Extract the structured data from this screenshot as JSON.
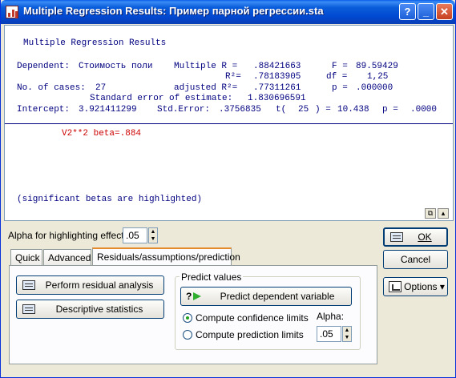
{
  "window": {
    "title": "Multiple Regression Results: Пример парной регрессии.sta"
  },
  "titlebar_buttons": {
    "help": "?",
    "minimize": "_",
    "close": "✕"
  },
  "output": {
    "heading": "Multiple Regression Results",
    "dependent_label": "Dependent:",
    "dependent_value": "Стоимость поли",
    "multiple_r_label": "Multiple R =",
    "multiple_r_value": ".88421663",
    "f_label": "F =",
    "f_value": "89.59429",
    "r2_label": "R²=",
    "r2_value": ".78183905",
    "df_label": "df =",
    "df_value": "1,25",
    "cases_label": "No. of cases:",
    "cases_value": "27",
    "adj_r2_label": "adjusted R²=",
    "adj_r2_value": ".77311261",
    "p_label": "p =",
    "p_value": ".000000",
    "std_err_label": "Standard error of estimate:",
    "std_err_value": "1.830696591",
    "intercept_label": "Intercept:",
    "intercept_value": "3.921411299",
    "intercept_se_label": "Std.Error:",
    "intercept_se_value": ".3756835",
    "t_label": "t(",
    "t_df": "25",
    "t_eq": ") =",
    "t_value": "10.438",
    "intercept_p_label": "p =",
    "intercept_p_value": ".0000",
    "beta_line": "V2**2 beta=.884",
    "footnote": "(significant betas are highlighted)"
  },
  "alpha_highlight": {
    "label": "Alpha for highlighting effects:",
    "value": ".05"
  },
  "buttons": {
    "ok": "OK",
    "cancel": "Cancel",
    "options": "Options ▾"
  },
  "tabs": [
    {
      "label": "Quick"
    },
    {
      "label": "Advanced"
    },
    {
      "label": "Residuals/assumptions/prediction"
    }
  ],
  "panel": {
    "perform_residual": "Perform residual analysis",
    "descriptive_stats": "Descriptive statistics",
    "predict_group_title": "Predict values",
    "predict_dependent": "Predict dependent variable",
    "confidence_limits": "Compute confidence limits",
    "prediction_limits": "Compute prediction limits",
    "alpha_label": "Alpha:",
    "alpha_value": ".05"
  },
  "colors": {
    "title_blue": "#0048d1",
    "output_text": "#000080",
    "beta_red": "#cc0000"
  }
}
